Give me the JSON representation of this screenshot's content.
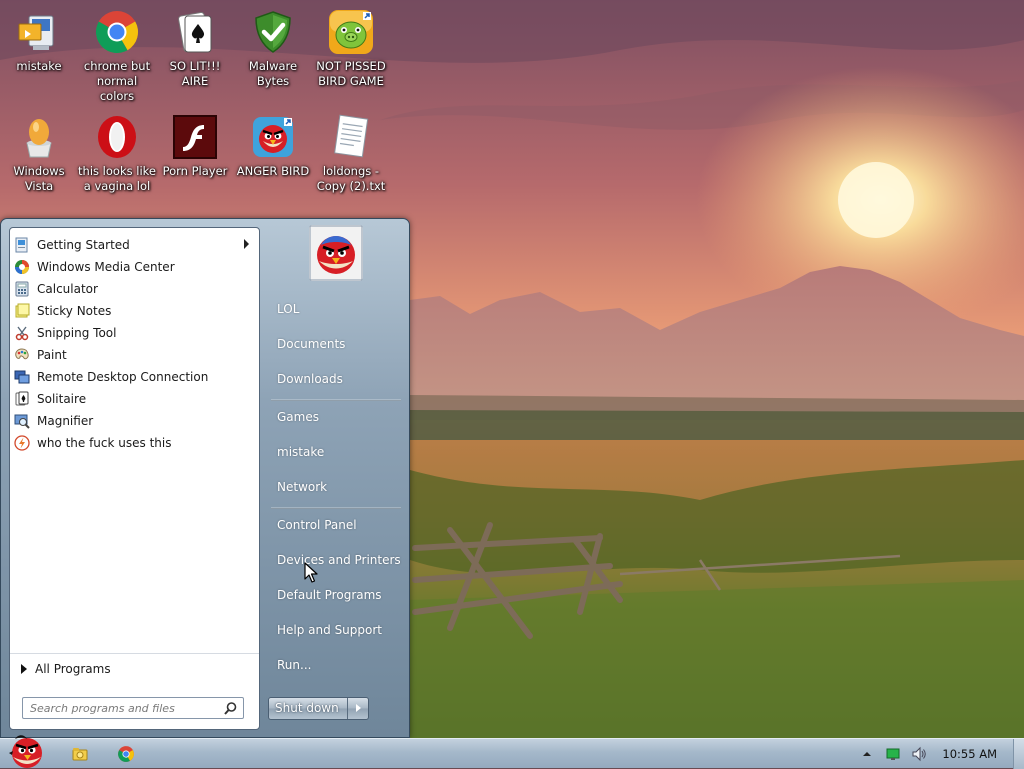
{
  "desktop": {
    "icons": [
      {
        "label": "mistake",
        "icon": "monitor-shortcut-icon"
      },
      {
        "label": "chrome but normal colors",
        "icon": "chrome-icon"
      },
      {
        "label": "SO LIT!!! AIRE",
        "icon": "solitaire-card-icon"
      },
      {
        "label": "Malware Bytes",
        "icon": "malwarebytes-shield-icon"
      },
      {
        "label": "NOT PISSED BIRD GAME",
        "icon": "green-pig-icon"
      },
      {
        "label": "Windows Vista",
        "icon": "egg-icon"
      },
      {
        "label": "this looks like a vagina lol",
        "icon": "opera-icon"
      },
      {
        "label": "Porn Player",
        "icon": "flash-player-icon"
      },
      {
        "label": "ANGER BIRD",
        "icon": "angry-bird-icon"
      },
      {
        "label": "loldongs - Copy (2).txt",
        "icon": "text-file-icon"
      }
    ]
  },
  "start_menu": {
    "programs": [
      {
        "label": "Getting Started",
        "icon": "getting-started-icon",
        "has_submenu": true
      },
      {
        "label": "Windows Media Center",
        "icon": "media-center-icon"
      },
      {
        "label": "Calculator",
        "icon": "calculator-icon"
      },
      {
        "label": "Sticky Notes",
        "icon": "sticky-notes-icon"
      },
      {
        "label": "Snipping Tool",
        "icon": "snipping-tool-icon"
      },
      {
        "label": "Paint",
        "icon": "paint-icon"
      },
      {
        "label": "Remote Desktop Connection",
        "icon": "remote-desktop-icon"
      },
      {
        "label": "Solitaire",
        "icon": "solitaire-icon"
      },
      {
        "label": "Magnifier",
        "icon": "magnifier-icon"
      },
      {
        "label": "who the fuck uses this",
        "icon": "flash-circle-icon"
      }
    ],
    "all_programs": "All Programs",
    "search": {
      "placeholder": "Search programs and files"
    },
    "right_pane": {
      "items": [
        "LOL",
        "Documents",
        "Downloads",
        "Games",
        "mistake",
        "Network",
        "Control Panel",
        "Devices and Printers",
        "Default Programs",
        "Help and Support",
        "Run..."
      ]
    },
    "shutdown_label": "Shut down"
  },
  "taskbar": {
    "clock": "10:55 AM",
    "pinned": [
      "explorer-icon",
      "chrome-icon"
    ],
    "tray": [
      "show-hidden-icons-arrow-icon",
      "network-icon",
      "volume-icon"
    ]
  },
  "colors": {
    "menu_accent": "#6f869a",
    "taskbar": "#a5b8ca"
  }
}
